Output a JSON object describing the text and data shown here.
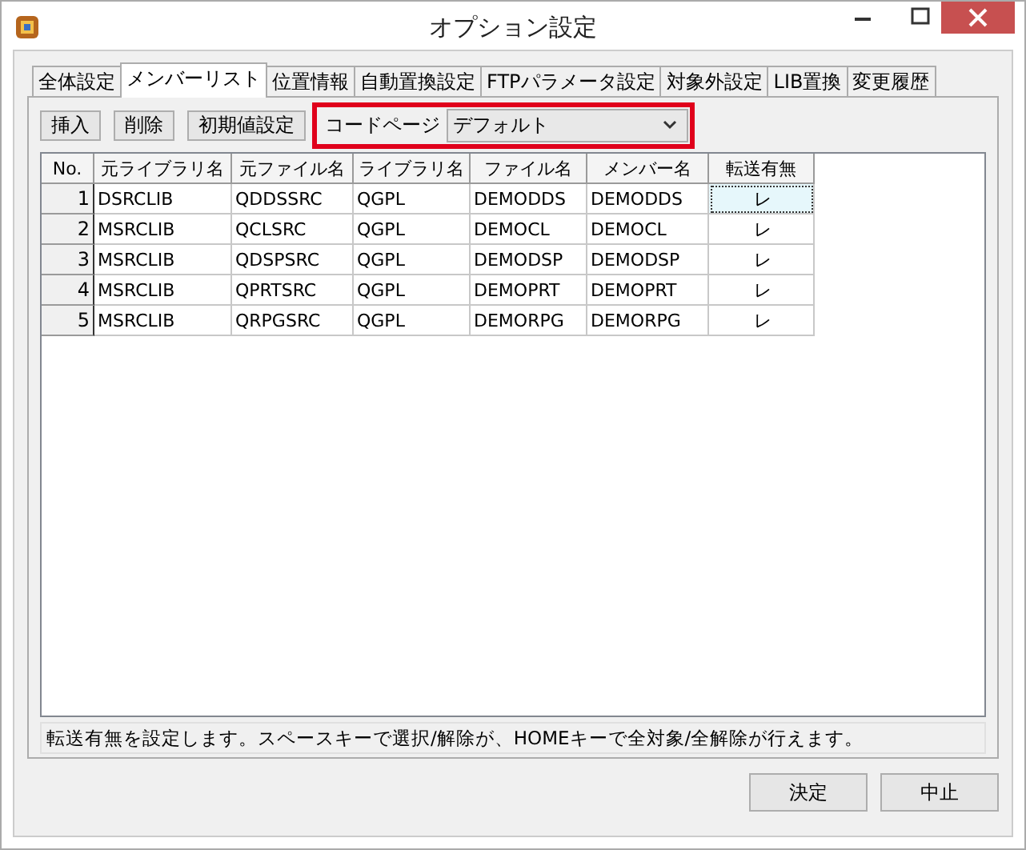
{
  "window": {
    "title": "オプション設定"
  },
  "tabs": [
    {
      "label": "全体設定",
      "selected": false
    },
    {
      "label": "メンバーリスト",
      "selected": true
    },
    {
      "label": "位置情報",
      "selected": false
    },
    {
      "label": "自動置換設定",
      "selected": false
    },
    {
      "label": "FTPパラメータ設定",
      "selected": false
    },
    {
      "label": "対象外設定",
      "selected": false
    },
    {
      "label": "LIB置換",
      "selected": false
    },
    {
      "label": "変更履歴",
      "selected": false
    }
  ],
  "toolbar": {
    "buttons": [
      "挿入",
      "削除",
      "初期値設定"
    ],
    "codepage": {
      "label": "コードページ",
      "value": "デフォルト",
      "highlighted": true
    }
  },
  "table": {
    "columns": [
      "No.",
      "元ライブラリ名",
      "元ファイル名",
      "ライブラリ名",
      "ファイル名",
      "メンバー名",
      "転送有無"
    ],
    "rows": [
      {
        "cells": [
          "1",
          "DSRCLIB",
          "QDDSSRC",
          "QGPL",
          "DEMODDS",
          "DEMODDS",
          "レ"
        ],
        "selected": true
      },
      {
        "cells": [
          "2",
          "MSRCLIB",
          "QCLSRC",
          "QGPL",
          "DEMOCL",
          "DEMOCL",
          "レ"
        ],
        "selected": false
      },
      {
        "cells": [
          "3",
          "MSRCLIB",
          "QDSPSRC",
          "QGPL",
          "DEMODSP",
          "DEMODSP",
          "レ"
        ],
        "selected": false
      },
      {
        "cells": [
          "4",
          "MSRCLIB",
          "QPRTSRC",
          "QGPL",
          "DEMOPRT",
          "DEMOPRT",
          "レ"
        ],
        "selected": false
      },
      {
        "cells": [
          "5",
          "MSRCLIB",
          "QRPGSRC",
          "QGPL",
          "DEMORPG",
          "DEMORPG",
          "レ"
        ],
        "selected": false
      }
    ]
  },
  "status_bar": "転送有無を設定します。スペースキーで選択/解除が、HOMEキーで全対象/全解除が行えます。",
  "buttons": [
    "決定",
    "中止"
  ]
}
